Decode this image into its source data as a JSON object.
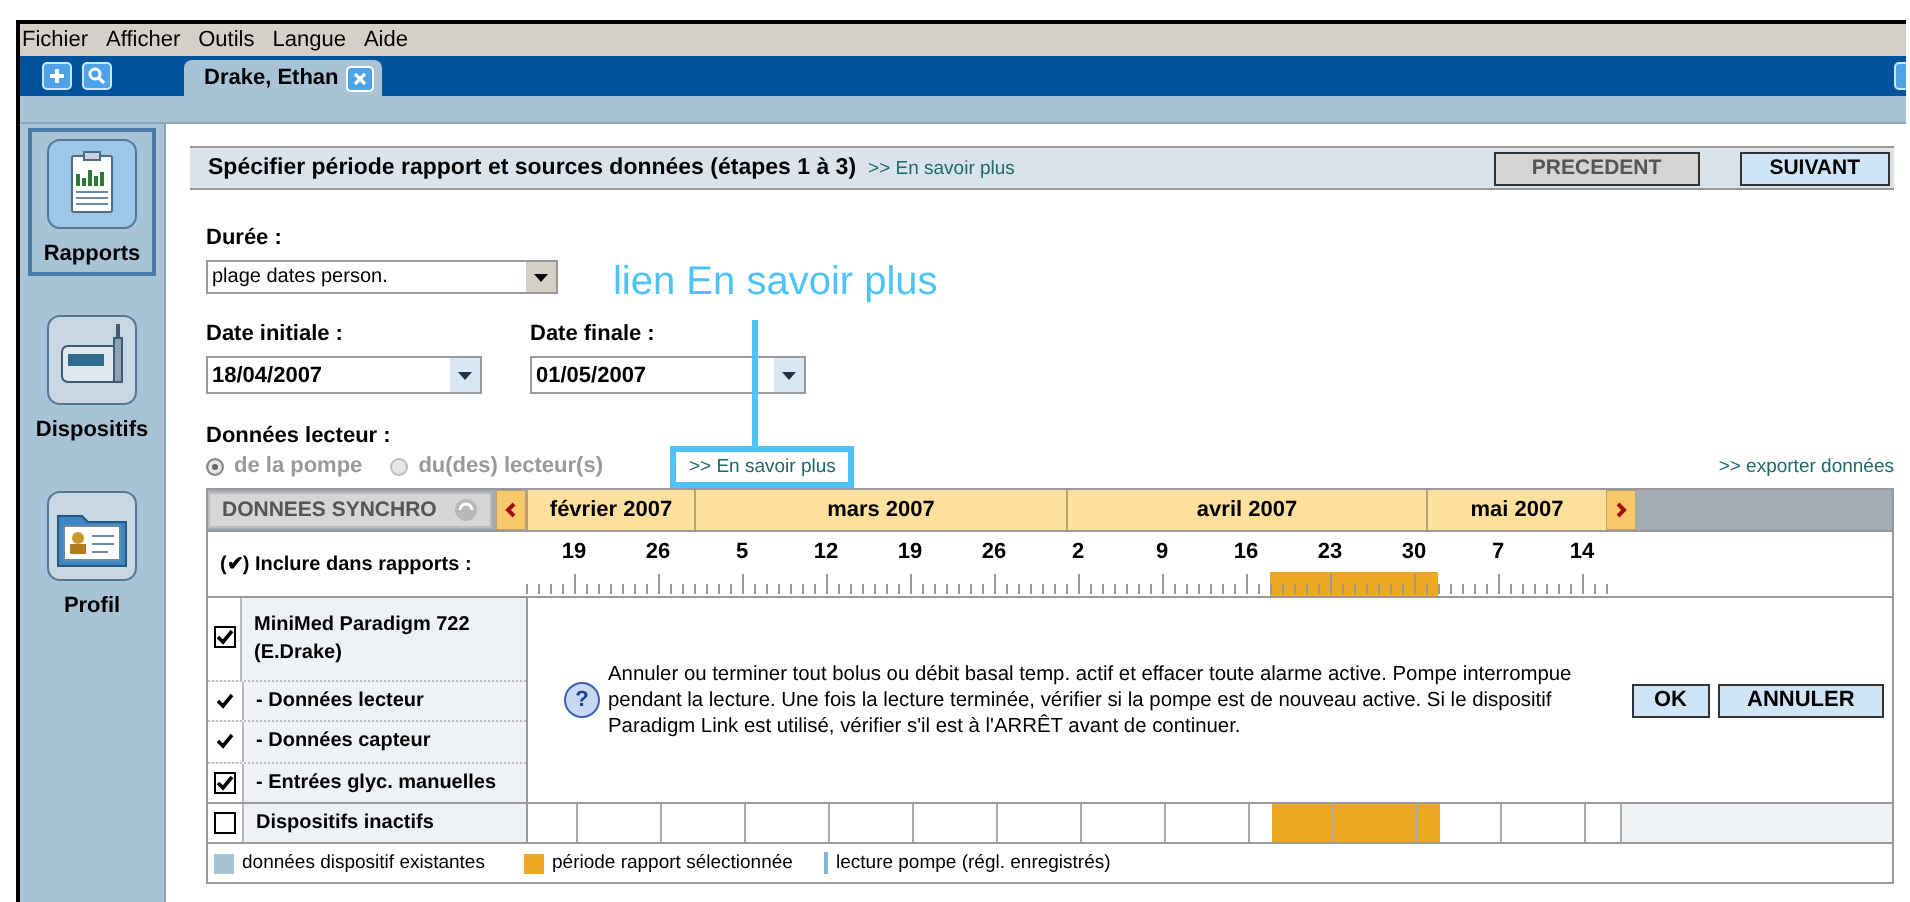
{
  "menu": [
    "Fichier",
    "Afficher",
    "Outils",
    "Langue",
    "Aide"
  ],
  "tabs": [
    {
      "label": "Drake, Ethan",
      "selected": true
    }
  ],
  "sidebar": {
    "items": [
      {
        "label": "Rapports",
        "kind": "reports",
        "selected": true
      },
      {
        "label": "Dispositifs",
        "kind": "devices",
        "selected": false
      },
      {
        "label": "Profil",
        "kind": "profile",
        "selected": false
      }
    ]
  },
  "header": {
    "title": "Spécifier période rapport et sources données (étapes 1 à 3)",
    "link": ">> En savoir plus",
    "buttons": [
      {
        "label": "PRECEDENT",
        "disabled": true
      },
      {
        "label": "SUIVANT",
        "disabled": false
      }
    ]
  },
  "duration": {
    "label": "Durée :",
    "value": "plage dates person."
  },
  "start_date": {
    "label": "Date initiale :",
    "value": "18/04/2007"
  },
  "end_date": {
    "label": "Date finale :",
    "value": "01/05/2007"
  },
  "meter_data": {
    "label": "Données lecteur :",
    "link": ">> En savoir plus",
    "options": [
      {
        "label": "de la pompe",
        "selected": true,
        "disabled": true
      },
      {
        "label": "du(des) lecteur(s)",
        "selected": false,
        "disabled": true
      }
    ]
  },
  "export_link": ">> exporter données",
  "annotation": {
    "label": "lien En savoir plus"
  },
  "timeline": {
    "sync_button": "DONNEES SYNCHRO",
    "months": [
      "février 2007",
      "mars 2007",
      "avril 2007",
      "mai 2007"
    ],
    "include_label": "(✔) Inclure dans rapports :",
    "ticks": [
      "19",
      "26",
      "5",
      "12",
      "19",
      "26",
      "2",
      "9",
      "16",
      "23",
      "30",
      "7",
      "14"
    ],
    "devices": [
      {
        "label": "MiniMed Paradigm 722 (E.Drake)",
        "kind": "checkbox",
        "checked": true
      },
      {
        "label": "- Données lecteur",
        "kind": "tick",
        "checked": true
      },
      {
        "label": "- Données capteur",
        "kind": "tick",
        "checked": true
      },
      {
        "label": "- Entrées glyc. manuelles",
        "kind": "checkbox",
        "checked": true
      }
    ],
    "inactive": {
      "label": "Dispositifs inactifs",
      "checked": false
    },
    "message": {
      "icon": "?",
      "text": "Annuler ou terminer tout bolus ou débit basal temp. actif et effacer toute alarme active. Pompe interrompue pendant la lecture. Une fois la lecture terminée, vérifier si la pompe est de nouveau active. Si le dispositif Paradigm Link est utilisé, vérifier s'il est à l'ARRÊT avant de continuer.",
      "buttons": [
        "OK",
        "ANNULER"
      ]
    },
    "legend": [
      {
        "label": "données dispositif existantes",
        "kind": "swatch",
        "color": "#a8c2d6"
      },
      {
        "label": "période rapport sélectionnée",
        "kind": "swatch",
        "color": "#eba820"
      },
      {
        "label": "lecture pompe (régl. enregistrés)",
        "kind": "line",
        "color": "#7fb6dc"
      }
    ]
  }
}
